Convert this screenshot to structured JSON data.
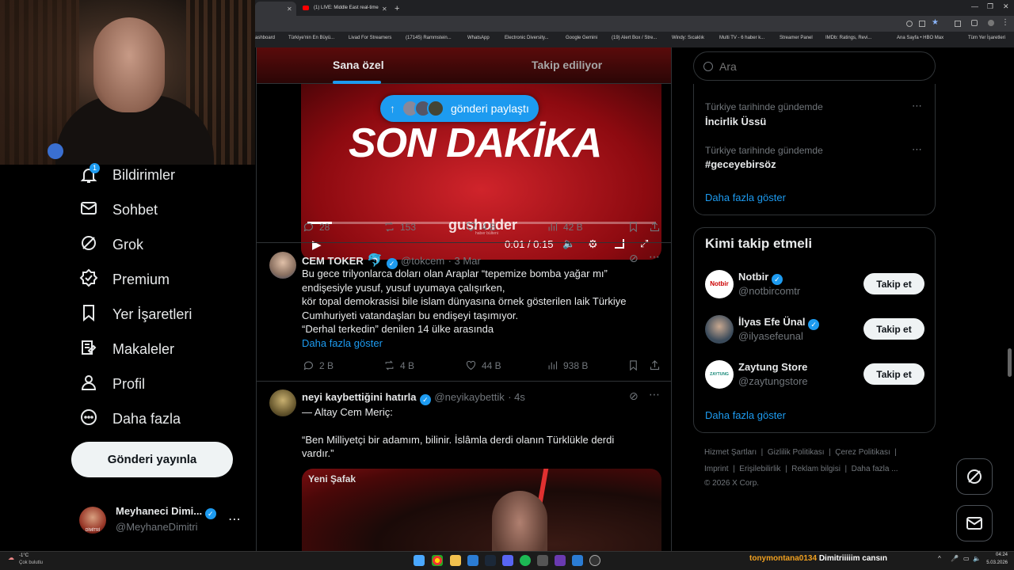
{
  "browser": {
    "tabs": [
      {
        "label": ""
      },
      {
        "label": "(1) LIVE: Middle East real-time"
      }
    ],
    "bookmarks": [
      "ashboard",
      "Türkiye'nin En Büyü...",
      "Livad For Streamers",
      "(17145) Rammstein...",
      "WhatsApp",
      "Electronic Diversity...",
      "Google Gemini",
      "(19) Alert Box / Stre...",
      "Windy: Sıcaklık",
      "Multi TV - 6 haber k...",
      "Streamer Panel",
      "IMDb: Ratings, Revi...",
      "Ana Sayfa • HBO Max",
      "Tüm Yer İşaretleri"
    ]
  },
  "nav": {
    "items": [
      {
        "label": "Bildirimler",
        "icon": "bell-icon",
        "badge": "1"
      },
      {
        "label": "Sohbet",
        "icon": "mail-icon"
      },
      {
        "label": "Grok",
        "icon": "grok-icon"
      },
      {
        "label": "Premium",
        "icon": "premium-icon"
      },
      {
        "label": "Yer İşaretleri",
        "icon": "bookmark-icon"
      },
      {
        "label": "Makaleler",
        "icon": "article-icon"
      },
      {
        "label": "Profil",
        "icon": "person-icon"
      },
      {
        "label": "Daha fazla",
        "icon": "more-circle-icon"
      }
    ],
    "post_button": "Gönderi yayınla",
    "profile": {
      "name": "Meyhaneci Dimi...",
      "handle": "@MeyhaneDimitri",
      "avatar_text": "DİMİTRİ"
    }
  },
  "feed": {
    "tabs": [
      "Sana özel",
      "Takip ediliyor"
    ],
    "banner": "gönderi paylaştı",
    "video": {
      "headline": "SON DAKİKA",
      "watermark": "gusholder",
      "watermark_sub": "haber bülteni",
      "time": "0:01 / 0:15",
      "progress": 0.07,
      "stats": {
        "replies": "28",
        "reposts": "153",
        "likes": "4 B",
        "views": "42 B"
      }
    },
    "tweets": [
      {
        "name": "CEM TOKER",
        "emoji": "🐬",
        "handle": "@tokcem",
        "time": "· 3 Mar",
        "lines": [
          "Bu gece trilyonlarca doları olan Araplar “tepemize bomba yağar mı”",
          "endişesiyle yusuf, yusuf uyumaya çalışırken,",
          "kör topal demokrasisi bile islam dünyasına örnek gösterilen laik Türkiye",
          "Cumhuriyeti vatandaşları bu endişeyi taşımıyor.",
          "“Derhal terkedin” denilen 14 ülke arasında"
        ],
        "more": "Daha fazla göster",
        "stats": {
          "replies": "2 B",
          "reposts": "4 B",
          "likes": "44 B",
          "views": "938 B"
        }
      },
      {
        "name": "neyi kaybettiğini hatırla",
        "handle": "@neyikaybettik",
        "time": "· 4s",
        "lines": [
          "— Altay Cem Meriç:",
          "",
          "“Ben Milliyetçi bir adamım, bilinir. İslâmla derdi olanın Türklükle derdi",
          "vardır.”"
        ],
        "media_label": "Yeni Şafak"
      }
    ]
  },
  "sidebar": {
    "search_placeholder": "Ara",
    "trends": [
      {
        "context": "Türkiye tarihinde gündemde",
        "topic": "İncirlik Üssü"
      },
      {
        "context": "Türkiye tarihinde gündemde",
        "topic": "#geceyebirsöz"
      }
    ],
    "trends_more": "Daha fazla göster",
    "who_to_follow": {
      "title": "Kimi takip etmeli",
      "accounts": [
        {
          "name": "Notbir",
          "handle": "@notbircomtr",
          "button": "Takip et",
          "avatar": "Notbir"
        },
        {
          "name": "İlyas Efe Ünal",
          "handle": "@ilyasefeunal",
          "button": "Takip et",
          "avatar": ""
        },
        {
          "name": "Zaytung Store",
          "handle": "@zaytungstore",
          "button": "Takip et",
          "avatar": "ZAYTUNG STORE"
        }
      ],
      "more": "Daha fazla göster"
    },
    "footer": [
      "Hizmet Şartları",
      "Gizlilik Politikası",
      "Çerez Politikası",
      "Imprint",
      "Erişilebilirlik",
      "Reklam bilgisi",
      "Daha fazla ...",
      "© 2026 X Corp."
    ]
  },
  "taskbar": {
    "weather_temp": "-1°C",
    "weather_text": "Çok bulutlu",
    "chat_user": "tonymontana0134",
    "chat_message": "Dimitriiiiim cansın",
    "time": "04:24",
    "date": "5.03.2026"
  }
}
